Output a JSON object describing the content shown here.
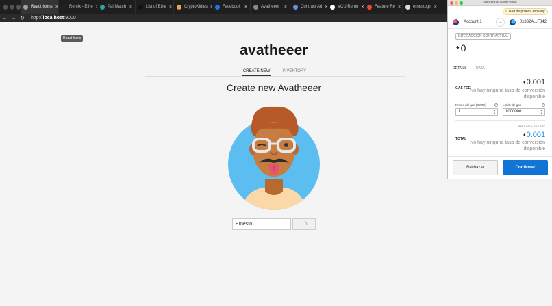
{
  "browser": {
    "tabs": [
      {
        "label": "React Icons",
        "active": true,
        "color": "#9aa0a6"
      },
      {
        "label": "Remix - Ethe",
        "active": false,
        "color": "#222222"
      },
      {
        "label": "PairMatch",
        "active": false,
        "color": "#2aa5a0"
      },
      {
        "label": "List of Ethe",
        "active": false,
        "color": "#111111"
      },
      {
        "label": "CryptoKitties",
        "active": false,
        "color": "#f0a24b"
      },
      {
        "label": "Facebook",
        "active": false,
        "color": "#1877f2"
      },
      {
        "label": "Avatheeer",
        "active": false,
        "color": "#888888"
      },
      {
        "label": "Contract Ad",
        "active": false,
        "color": "#6b8cde"
      },
      {
        "label": "VCU Remo",
        "active": false,
        "color": "#ffffff"
      },
      {
        "label": "Feature Re",
        "active": false,
        "color": "#e6492d"
      },
      {
        "label": "ernestogn",
        "active": false,
        "color": "#dddddd"
      }
    ],
    "address": {
      "scheme": "http://",
      "host": "localhost",
      "port": ":9000"
    },
    "tooltip": "React Icons"
  },
  "page": {
    "title": "avatheeer",
    "nav": [
      {
        "label": "CREATE NEW",
        "active": true
      },
      {
        "label": "INVENTORY",
        "active": false
      }
    ],
    "heading": "Create new Avatheeer",
    "name_input": {
      "value": "Ernesto"
    }
  },
  "metamask": {
    "window_title": "MetaMask Notification",
    "network": "Red de prueba Rinkeby",
    "account_name": "Account 1",
    "to_address": "0x332A...F842",
    "contract_tag": "INTERACCIÓN CONTRACTUAL",
    "amount": "0",
    "tabs": [
      {
        "label": "DETAILS",
        "active": true
      },
      {
        "label": "DATA",
        "active": false
      }
    ],
    "gas_fee_label": "GAS FEE",
    "gas_fee_value": "0.001",
    "no_conversion": "No hay ninguna tasa de conversión disponible",
    "gas_price_label": "Precio del gas (GWEI)",
    "gas_price_value": "1",
    "gas_limit_label": "Límite de gas",
    "gas_limit_value": "1000000",
    "amount_gas_label": "AMOUNT + GAS FEE",
    "total_label": "TOTAL",
    "total_value": "0.001",
    "reject_label": "Rechazar",
    "confirm_label": "Confirmar"
  }
}
